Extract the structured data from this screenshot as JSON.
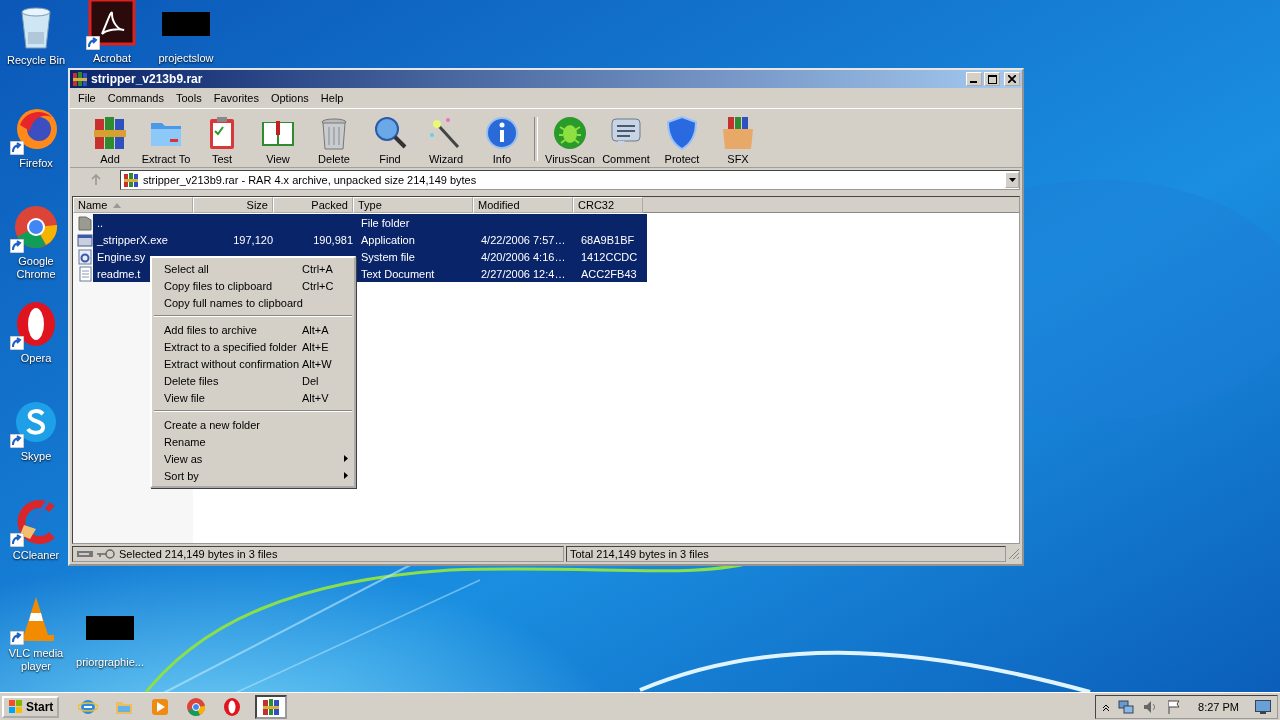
{
  "desktop_icons": [
    {
      "label": "Recycle Bin",
      "kind": "recycle-bin",
      "shortcut": false
    },
    {
      "label": "Acrobat",
      "kind": "acrobat",
      "shortcut": true
    },
    {
      "label": "projectslow",
      "kind": "black-thumbnail",
      "shortcut": false
    },
    {
      "label": "Firefox",
      "kind": "firefox",
      "shortcut": true
    },
    {
      "label": "Google Chrome",
      "kind": "chrome",
      "shortcut": true
    },
    {
      "label": "Opera",
      "kind": "opera",
      "shortcut": true
    },
    {
      "label": "Skype",
      "kind": "skype",
      "shortcut": true
    },
    {
      "label": "CCleaner",
      "kind": "ccleaner",
      "shortcut": true
    },
    {
      "label": "VLC media player",
      "kind": "vlc",
      "shortcut": true
    },
    {
      "label": "priorgraphie...",
      "kind": "black-thumbnail",
      "shortcut": false
    }
  ],
  "window": {
    "title": "stripper_v213b9.rar",
    "menu": [
      "File",
      "Commands",
      "Tools",
      "Favorites",
      "Options",
      "Help"
    ],
    "toolbar_groups": [
      [
        {
          "label": "Add",
          "kind": "add"
        },
        {
          "label": "Extract To",
          "kind": "extract"
        },
        {
          "label": "Test",
          "kind": "test"
        },
        {
          "label": "View",
          "kind": "view"
        },
        {
          "label": "Delete",
          "kind": "delete"
        },
        {
          "label": "Find",
          "kind": "find"
        },
        {
          "label": "Wizard",
          "kind": "wizard"
        },
        {
          "label": "Info",
          "kind": "info"
        }
      ],
      [
        {
          "label": "VirusScan",
          "kind": "virusscan"
        },
        {
          "label": "Comment",
          "kind": "comment"
        },
        {
          "label": "Protect",
          "kind": "protect"
        },
        {
          "label": "SFX",
          "kind": "sfx"
        }
      ]
    ],
    "address": "stripper_v213b9.rar - RAR 4.x archive, unpacked size 214,149 bytes",
    "columns": [
      {
        "label": "Name",
        "sorted": true
      },
      {
        "label": "Size",
        "sorted": false
      },
      {
        "label": "Packed",
        "sorted": false
      },
      {
        "label": "Type",
        "sorted": false
      },
      {
        "label": "Modified",
        "sorted": false
      },
      {
        "label": "CRC32",
        "sorted": false
      }
    ],
    "rows": [
      {
        "kind": "folder",
        "selected": true,
        "cells": [
          "..",
          "",
          "",
          "File folder",
          "",
          ""
        ]
      },
      {
        "kind": "exe",
        "selected": true,
        "cells": [
          "_stripperX.exe",
          "197,120",
          "190,981",
          "Application",
          "4/22/2006 7:57…",
          "68A9B1BF"
        ]
      },
      {
        "kind": "sys",
        "selected": true,
        "cells": [
          "Engine.sy",
          "",
          "",
          "System file",
          "4/20/2006 4:16…",
          "1412CCDC"
        ]
      },
      {
        "kind": "txt",
        "selected": true,
        "cells": [
          "readme.t",
          "",
          "",
          "Text Document",
          "2/27/2006 12:4…",
          "ACC2FB43"
        ]
      }
    ],
    "context_menu": [
      [
        {
          "label": "Select all",
          "shortcut": "Ctrl+A",
          "submenu": false
        },
        {
          "label": "Copy files to clipboard",
          "shortcut": "Ctrl+C",
          "submenu": false
        },
        {
          "label": "Copy full names to clipboard",
          "submenu": false
        }
      ],
      [
        {
          "label": "Add files to archive",
          "shortcut": "Alt+A",
          "submenu": false
        },
        {
          "label": "Extract to a specified folder",
          "shortcut": "Alt+E",
          "submenu": false
        },
        {
          "label": "Extract without confirmation",
          "shortcut": "Alt+W",
          "submenu": false
        },
        {
          "label": "Delete files",
          "shortcut": "Del",
          "submenu": false
        },
        {
          "label": "View file",
          "shortcut": "Alt+V",
          "submenu": false
        }
      ],
      [
        {
          "label": "Create a new folder",
          "submenu": false
        },
        {
          "label": "Rename",
          "submenu": false
        },
        {
          "label": "View as",
          "submenu": true
        },
        {
          "label": "Sort by",
          "submenu": true
        }
      ]
    ],
    "status_bar": {
      "left": "Selected 214,149 bytes in 3 files",
      "right": "Total 214,149 bytes in 3 files"
    }
  },
  "taskbar": {
    "start": "Start",
    "apps": [
      {
        "kind": "ie",
        "selected": false
      },
      {
        "kind": "explorer",
        "selected": false
      },
      {
        "kind": "media",
        "selected": false
      },
      {
        "kind": "chrome",
        "selected": false
      },
      {
        "kind": "opera",
        "selected": false
      },
      {
        "kind": "winrar",
        "selected": true
      }
    ],
    "clock": "8:27 PM"
  }
}
